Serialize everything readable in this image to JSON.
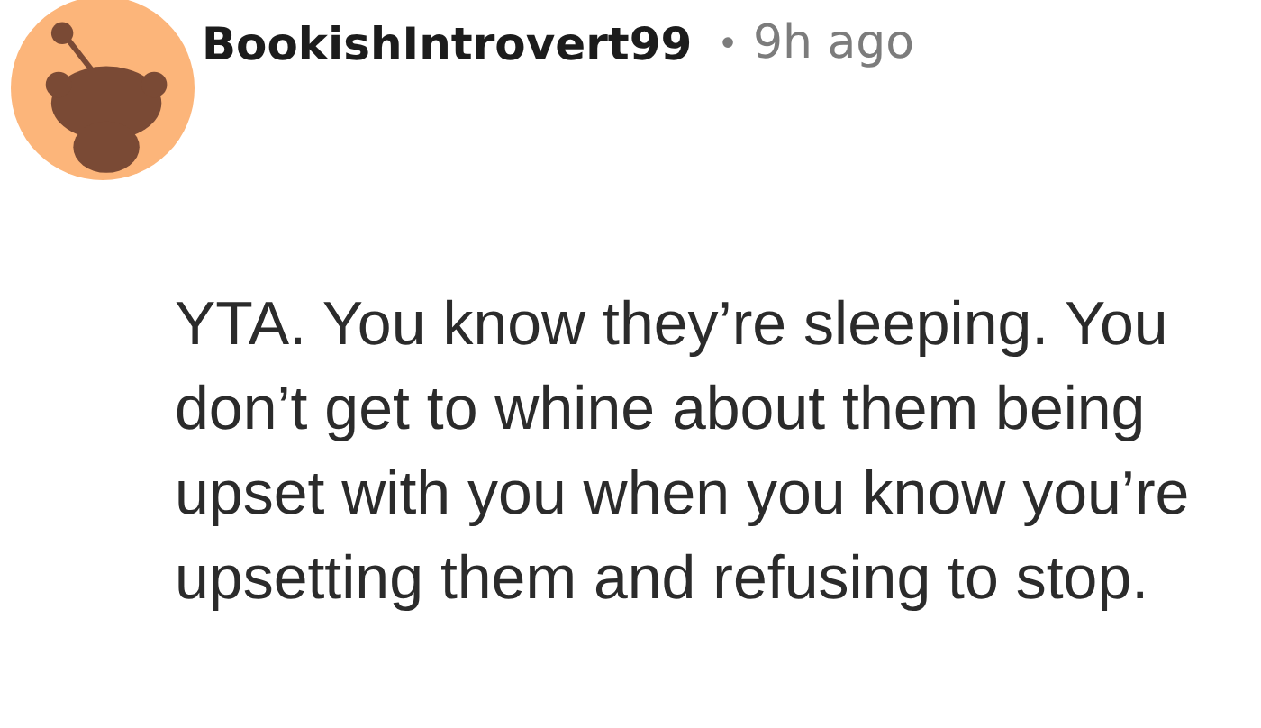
{
  "comment": {
    "author": "BookishIntrovert99",
    "separator": "•",
    "time": "9h ago",
    "body": "YTA. You know they’re sleeping. You don’t get to whine about them being upset with you when you know you’re upsetting them and refusing to stop."
  }
}
